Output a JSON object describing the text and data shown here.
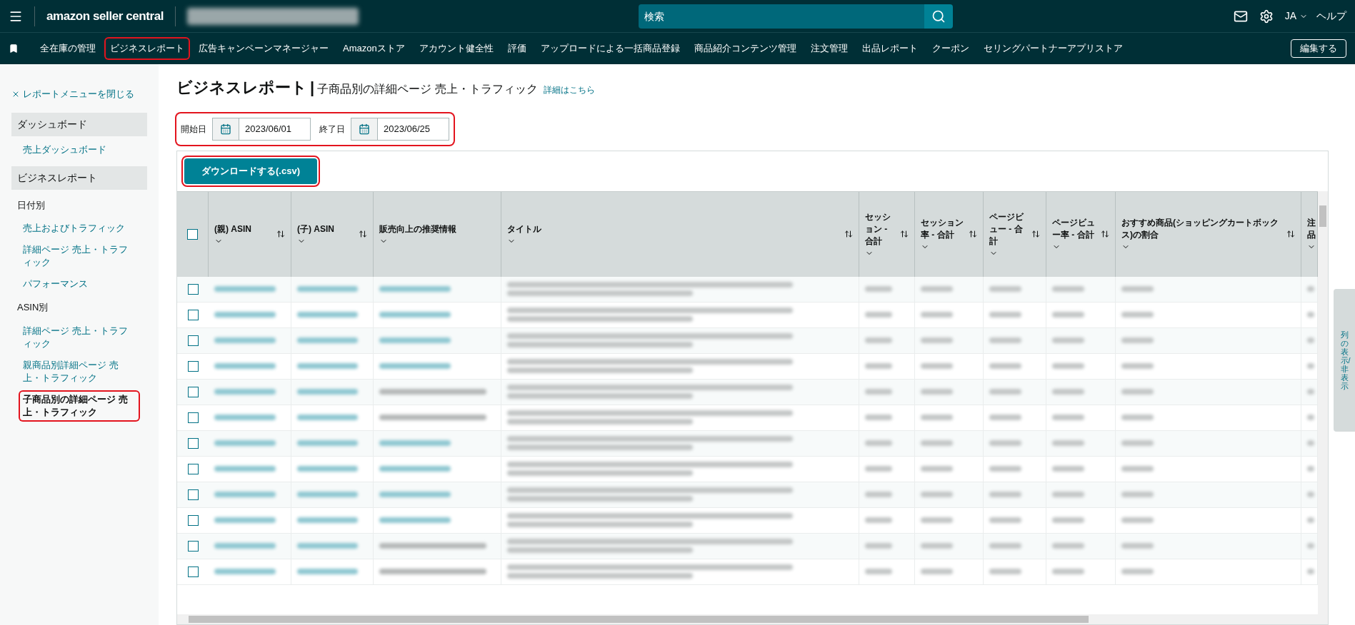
{
  "top_bar": {
    "logo": "amazon seller central",
    "search": {
      "placeholder": "検索"
    },
    "language": "JA",
    "help": "ヘルプ"
  },
  "nav": {
    "items": [
      {
        "label": "全在庫の管理",
        "highlighted": false
      },
      {
        "label": "ビジネスレポート",
        "highlighted": true
      },
      {
        "label": "広告キャンペーンマネージャー",
        "highlighted": false
      },
      {
        "label": "Amazonストア",
        "highlighted": false
      },
      {
        "label": "アカウント健全性",
        "highlighted": false
      },
      {
        "label": "評価",
        "highlighted": false
      },
      {
        "label": "アップロードによる一括商品登録",
        "highlighted": false
      },
      {
        "label": "商品紹介コンテンツ管理",
        "highlighted": false
      },
      {
        "label": "注文管理",
        "highlighted": false
      },
      {
        "label": "出品レポート",
        "highlighted": false
      },
      {
        "label": "クーポン",
        "highlighted": false
      },
      {
        "label": "セリングパートナーアプリストア",
        "highlighted": false
      }
    ],
    "edit_button": "編集する"
  },
  "sidebar": {
    "close_link": "レポートメニューを閉じる",
    "sections": [
      {
        "title": "ダッシュボード",
        "groups": [
          {
            "items": [
              {
                "label": "売上ダッシュボード",
                "highlighted": false
              }
            ]
          }
        ]
      },
      {
        "title": "ビジネスレポート",
        "groups": [
          {
            "label": "日付別",
            "items": [
              {
                "label": "売上およびトラフィック",
                "highlighted": false
              },
              {
                "label": "詳細ページ 売上・トラフィック",
                "highlighted": false
              },
              {
                "label": "パフォーマンス",
                "highlighted": false
              }
            ]
          },
          {
            "label": "ASIN別",
            "items": [
              {
                "label": "詳細ページ 売上・トラフィック",
                "highlighted": false
              },
              {
                "label": "親商品別詳細ページ 売上・トラフィック",
                "highlighted": false
              },
              {
                "label": "子商品別の詳細ページ 売上・トラフィック",
                "highlighted": true
              }
            ]
          }
        ]
      }
    ]
  },
  "page": {
    "title": "ビジネスレポート",
    "separator": "|",
    "subtitle": "子商品別の詳細ページ 売上・トラフィック",
    "details_link": "詳細はこちら"
  },
  "date_range": {
    "highlighted": true,
    "start_label": "開始日",
    "start": "2023/06/01",
    "end_label": "終了日",
    "end": "2023/06/25"
  },
  "download_button": {
    "label": "ダウンロードする(.csv)",
    "highlighted": true
  },
  "table": {
    "select_all_checked": false,
    "columns": [
      {
        "label": "(親) ASIN",
        "sortable": true
      },
      {
        "label": "(子) ASIN",
        "sortable": true
      },
      {
        "label": "販売向上の推奨情報",
        "sortable": false
      },
      {
        "label": "タイトル",
        "sortable": true
      },
      {
        "label": "セッション - 合計",
        "sortable": true
      },
      {
        "label": "セッション率 - 合計",
        "sortable": true
      },
      {
        "label": "ページビュー - 合計",
        "sortable": true
      },
      {
        "label": "ページビュー率 - 合計",
        "sortable": true
      },
      {
        "label": "おすすめ商品(ショッピングカートボックス)の割合",
        "sortable": true
      },
      {
        "label": "注品",
        "sortable": false
      }
    ],
    "rows": [
      {
        "checked": false,
        "kind": "link"
      },
      {
        "checked": false,
        "kind": "link"
      },
      {
        "checked": false,
        "kind": "link"
      },
      {
        "checked": false,
        "kind": "link"
      },
      {
        "checked": false,
        "kind": "text"
      },
      {
        "checked": false,
        "kind": "text"
      },
      {
        "checked": false,
        "kind": "link"
      },
      {
        "checked": false,
        "kind": "link"
      },
      {
        "checked": false,
        "kind": "link"
      },
      {
        "checked": false,
        "kind": "link"
      },
      {
        "checked": false,
        "kind": "text"
      },
      {
        "checked": false,
        "kind": "text"
      }
    ]
  },
  "column_toggle": "列の表示/非表示"
}
